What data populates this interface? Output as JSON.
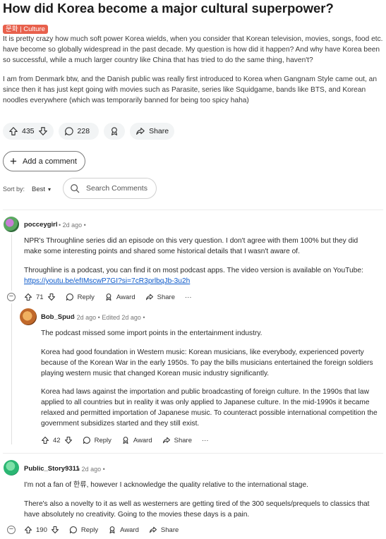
{
  "post": {
    "title": "How did Korea become a major cultural superpower?",
    "flair": "문화 | Culture",
    "flair_color": "#e8604c",
    "paragraphs": [
      "It is pretty crazy how much soft power Korea wields, when you consider that Korean television, movies, songs, food etc. have become so globally widespread in the past decade. My question is how did it happen? And why have Korea been so successful, while a much larger country like China that has tried to do the same thing, haven't?",
      "I am from Denmark btw, and the Danish public was really first introduced to Korea when Gangnam Style came out, an since then it has just kept going with movies such as Parasite, series like Squidgame, bands like BTS, and Korean noodles everywhere (which was temporarily banned for being too spicy haha)"
    ],
    "upvotes": "435",
    "comments_count": "228",
    "share_label": "Share"
  },
  "add_comment_label": "Add a comment",
  "sort": {
    "label": "Sort by:",
    "value": "Best"
  },
  "search": {
    "placeholder": "Search Comments"
  },
  "comments": [
    {
      "user": "pocceygirl",
      "meta": "• 2d ago •",
      "paragraphs": [
        "NPR's Throughline series did an episode on this very question. I don't agree with them 100% but they did make some interesting points and shared some historical details that I wasn't aware of.",
        "Throughline is a podcast, you can find it on most podcast apps. The video version is available on YouTube:"
      ],
      "link": "https://youtu.be/efIMscwP7GI?si=7cR3prlbqJb-3u2h",
      "upvotes": "71",
      "reply_label": "Reply",
      "award_label": "Award",
      "share_label": "Share",
      "more_label": "···"
    },
    {
      "user": "Bob_Spud",
      "meta": "• 2d ago • Edited 2d ago •",
      "paragraphs": [
        "The podcast missed some import points in the entertainment industry.",
        "Korea had good foundation in Western music: Korean musicians, like everybody, experienced poverty because of the Korean War in the early 1950s. To pay the bills musicians entertained the foreign soldiers playing western music that changed Korean music industry significantly.",
        "Korea had laws against the importation and public broadcasting of foreign culture. In the 1990s that law applied to all countries but in reality it was only applied to Japanese culture. In the mid-1990s it became relaxed and permitted importation of Japanese music. To counteract possible international competition the government subsidizes started and they still exist."
      ],
      "upvotes": "42",
      "reply_label": "Reply",
      "award_label": "Award",
      "share_label": "Share",
      "more_label": "···"
    },
    {
      "user": "Public_Story9311",
      "meta": "• 2d ago •",
      "paragraphs": [
        "I'm not a fan of 한류, however I acknowledge the quality relative to the international stage.",
        "There's also a novelty to it as well as westerners are getting tired of the 300 sequels/prequels to classics that have absolutely no creativity. Going to the movies these days is a pain."
      ],
      "upvotes": "190",
      "reply_label": "Reply",
      "award_label": "Award",
      "share_label": "Share"
    }
  ]
}
